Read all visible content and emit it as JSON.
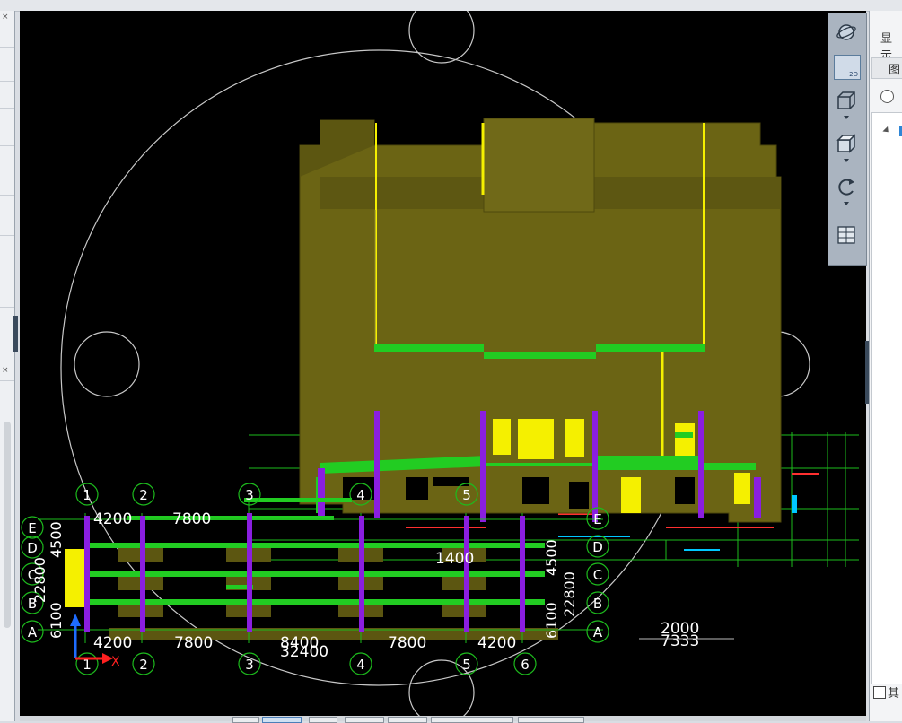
{
  "right_panel": {
    "title": "显示",
    "tab_label": "图",
    "footer_checkbox_label": "其"
  },
  "view_toolbar": {
    "buttons": [
      {
        "name": "orbit",
        "label": ""
      },
      {
        "name": "view-2d",
        "label": "2D"
      },
      {
        "name": "view-3d-wire",
        "label": ""
      },
      {
        "name": "view-3d-solid",
        "label": ""
      },
      {
        "name": "rotate",
        "label": ""
      },
      {
        "name": "layers",
        "label": ""
      }
    ]
  },
  "drawing": {
    "axis_top": [
      "1",
      "2",
      "3",
      "4",
      "5"
    ],
    "axis_bottom": [
      "1",
      "2",
      "3",
      "4",
      "5",
      "6"
    ],
    "axis_letters_right": [
      "E",
      "D",
      "C",
      "B",
      "A"
    ],
    "axis_letters_left": [
      "E",
      "D",
      "C",
      "B",
      "A"
    ],
    "dims_top": [
      "4200",
      "7800"
    ],
    "dims_bottom": [
      "4200",
      "7800",
      "8400",
      "7800",
      "4200"
    ],
    "dim_total": "32400",
    "dim_mid": "1400",
    "dim_far_1": "2000",
    "dim_far_2": "7333",
    "dims_vertical": [
      "22800",
      "6100",
      "4500"
    ],
    "axis_x_label": "X",
    "colors": {
      "background": "#000000",
      "slab": "#6b6414",
      "slab_edge": "#4e490d",
      "beam": "#22cc22",
      "column": "#8a1ee0",
      "highlight": "#f5f000",
      "axis_circle": "#1dbb1d",
      "compass": "#c8c8c8"
    }
  }
}
